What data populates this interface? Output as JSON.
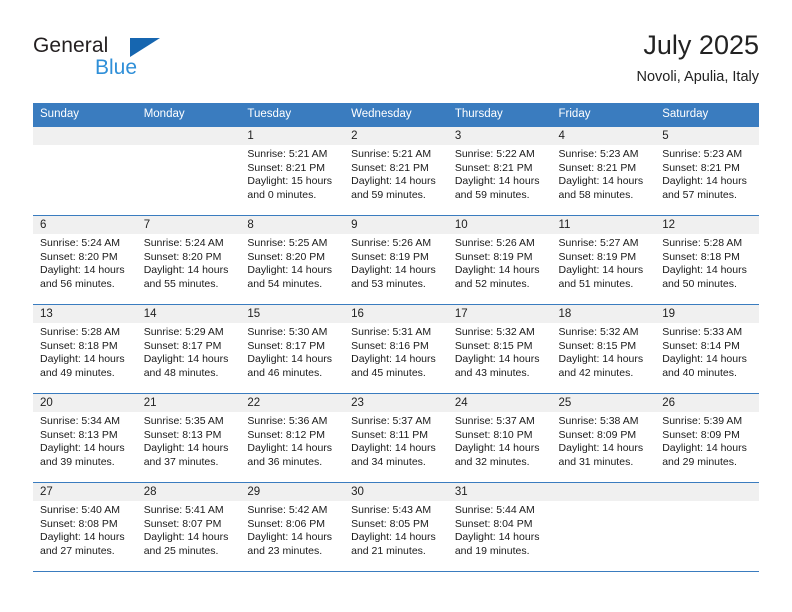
{
  "brand": {
    "name_dark": "General",
    "name_blue": "Blue",
    "triangle_icon": "brand-triangle-icon",
    "accent_dark": "#231f20",
    "accent_blue": "#2f8fd8",
    "triangle_color": "#1666b0"
  },
  "header": {
    "title": "July 2025",
    "subtitle": "Novoli, Apulia, Italy"
  },
  "theme": {
    "header_bg": "#3a7cbf",
    "header_text": "#ffffff",
    "daynum_bg": "#f0f0f0",
    "cell_bg": "#ffffff",
    "row_divider": "#3a7cbf"
  },
  "weekdays": [
    "Sunday",
    "Monday",
    "Tuesday",
    "Wednesday",
    "Thursday",
    "Friday",
    "Saturday"
  ],
  "weeks": [
    [
      {
        "empty": true
      },
      {
        "empty": true
      },
      {
        "day": "1",
        "sunrise": "Sunrise: 5:21 AM",
        "sunset": "Sunset: 8:21 PM",
        "daylight1": "Daylight: 15 hours",
        "daylight2": "and 0 minutes."
      },
      {
        "day": "2",
        "sunrise": "Sunrise: 5:21 AM",
        "sunset": "Sunset: 8:21 PM",
        "daylight1": "Daylight: 14 hours",
        "daylight2": "and 59 minutes."
      },
      {
        "day": "3",
        "sunrise": "Sunrise: 5:22 AM",
        "sunset": "Sunset: 8:21 PM",
        "daylight1": "Daylight: 14 hours",
        "daylight2": "and 59 minutes."
      },
      {
        "day": "4",
        "sunrise": "Sunrise: 5:23 AM",
        "sunset": "Sunset: 8:21 PM",
        "daylight1": "Daylight: 14 hours",
        "daylight2": "and 58 minutes."
      },
      {
        "day": "5",
        "sunrise": "Sunrise: 5:23 AM",
        "sunset": "Sunset: 8:21 PM",
        "daylight1": "Daylight: 14 hours",
        "daylight2": "and 57 minutes."
      }
    ],
    [
      {
        "day": "6",
        "sunrise": "Sunrise: 5:24 AM",
        "sunset": "Sunset: 8:20 PM",
        "daylight1": "Daylight: 14 hours",
        "daylight2": "and 56 minutes."
      },
      {
        "day": "7",
        "sunrise": "Sunrise: 5:24 AM",
        "sunset": "Sunset: 8:20 PM",
        "daylight1": "Daylight: 14 hours",
        "daylight2": "and 55 minutes."
      },
      {
        "day": "8",
        "sunrise": "Sunrise: 5:25 AM",
        "sunset": "Sunset: 8:20 PM",
        "daylight1": "Daylight: 14 hours",
        "daylight2": "and 54 minutes."
      },
      {
        "day": "9",
        "sunrise": "Sunrise: 5:26 AM",
        "sunset": "Sunset: 8:19 PM",
        "daylight1": "Daylight: 14 hours",
        "daylight2": "and 53 minutes."
      },
      {
        "day": "10",
        "sunrise": "Sunrise: 5:26 AM",
        "sunset": "Sunset: 8:19 PM",
        "daylight1": "Daylight: 14 hours",
        "daylight2": "and 52 minutes."
      },
      {
        "day": "11",
        "sunrise": "Sunrise: 5:27 AM",
        "sunset": "Sunset: 8:19 PM",
        "daylight1": "Daylight: 14 hours",
        "daylight2": "and 51 minutes."
      },
      {
        "day": "12",
        "sunrise": "Sunrise: 5:28 AM",
        "sunset": "Sunset: 8:18 PM",
        "daylight1": "Daylight: 14 hours",
        "daylight2": "and 50 minutes."
      }
    ],
    [
      {
        "day": "13",
        "sunrise": "Sunrise: 5:28 AM",
        "sunset": "Sunset: 8:18 PM",
        "daylight1": "Daylight: 14 hours",
        "daylight2": "and 49 minutes."
      },
      {
        "day": "14",
        "sunrise": "Sunrise: 5:29 AM",
        "sunset": "Sunset: 8:17 PM",
        "daylight1": "Daylight: 14 hours",
        "daylight2": "and 48 minutes."
      },
      {
        "day": "15",
        "sunrise": "Sunrise: 5:30 AM",
        "sunset": "Sunset: 8:17 PM",
        "daylight1": "Daylight: 14 hours",
        "daylight2": "and 46 minutes."
      },
      {
        "day": "16",
        "sunrise": "Sunrise: 5:31 AM",
        "sunset": "Sunset: 8:16 PM",
        "daylight1": "Daylight: 14 hours",
        "daylight2": "and 45 minutes."
      },
      {
        "day": "17",
        "sunrise": "Sunrise: 5:32 AM",
        "sunset": "Sunset: 8:15 PM",
        "daylight1": "Daylight: 14 hours",
        "daylight2": "and 43 minutes."
      },
      {
        "day": "18",
        "sunrise": "Sunrise: 5:32 AM",
        "sunset": "Sunset: 8:15 PM",
        "daylight1": "Daylight: 14 hours",
        "daylight2": "and 42 minutes."
      },
      {
        "day": "19",
        "sunrise": "Sunrise: 5:33 AM",
        "sunset": "Sunset: 8:14 PM",
        "daylight1": "Daylight: 14 hours",
        "daylight2": "and 40 minutes."
      }
    ],
    [
      {
        "day": "20",
        "sunrise": "Sunrise: 5:34 AM",
        "sunset": "Sunset: 8:13 PM",
        "daylight1": "Daylight: 14 hours",
        "daylight2": "and 39 minutes."
      },
      {
        "day": "21",
        "sunrise": "Sunrise: 5:35 AM",
        "sunset": "Sunset: 8:13 PM",
        "daylight1": "Daylight: 14 hours",
        "daylight2": "and 37 minutes."
      },
      {
        "day": "22",
        "sunrise": "Sunrise: 5:36 AM",
        "sunset": "Sunset: 8:12 PM",
        "daylight1": "Daylight: 14 hours",
        "daylight2": "and 36 minutes."
      },
      {
        "day": "23",
        "sunrise": "Sunrise: 5:37 AM",
        "sunset": "Sunset: 8:11 PM",
        "daylight1": "Daylight: 14 hours",
        "daylight2": "and 34 minutes."
      },
      {
        "day": "24",
        "sunrise": "Sunrise: 5:37 AM",
        "sunset": "Sunset: 8:10 PM",
        "daylight1": "Daylight: 14 hours",
        "daylight2": "and 32 minutes."
      },
      {
        "day": "25",
        "sunrise": "Sunrise: 5:38 AM",
        "sunset": "Sunset: 8:09 PM",
        "daylight1": "Daylight: 14 hours",
        "daylight2": "and 31 minutes."
      },
      {
        "day": "26",
        "sunrise": "Sunrise: 5:39 AM",
        "sunset": "Sunset: 8:09 PM",
        "daylight1": "Daylight: 14 hours",
        "daylight2": "and 29 minutes."
      }
    ],
    [
      {
        "day": "27",
        "sunrise": "Sunrise: 5:40 AM",
        "sunset": "Sunset: 8:08 PM",
        "daylight1": "Daylight: 14 hours",
        "daylight2": "and 27 minutes."
      },
      {
        "day": "28",
        "sunrise": "Sunrise: 5:41 AM",
        "sunset": "Sunset: 8:07 PM",
        "daylight1": "Daylight: 14 hours",
        "daylight2": "and 25 minutes."
      },
      {
        "day": "29",
        "sunrise": "Sunrise: 5:42 AM",
        "sunset": "Sunset: 8:06 PM",
        "daylight1": "Daylight: 14 hours",
        "daylight2": "and 23 minutes."
      },
      {
        "day": "30",
        "sunrise": "Sunrise: 5:43 AM",
        "sunset": "Sunset: 8:05 PM",
        "daylight1": "Daylight: 14 hours",
        "daylight2": "and 21 minutes."
      },
      {
        "day": "31",
        "sunrise": "Sunrise: 5:44 AM",
        "sunset": "Sunset: 8:04 PM",
        "daylight1": "Daylight: 14 hours",
        "daylight2": "and 19 minutes."
      },
      {
        "empty": true
      },
      {
        "empty": true
      }
    ]
  ]
}
